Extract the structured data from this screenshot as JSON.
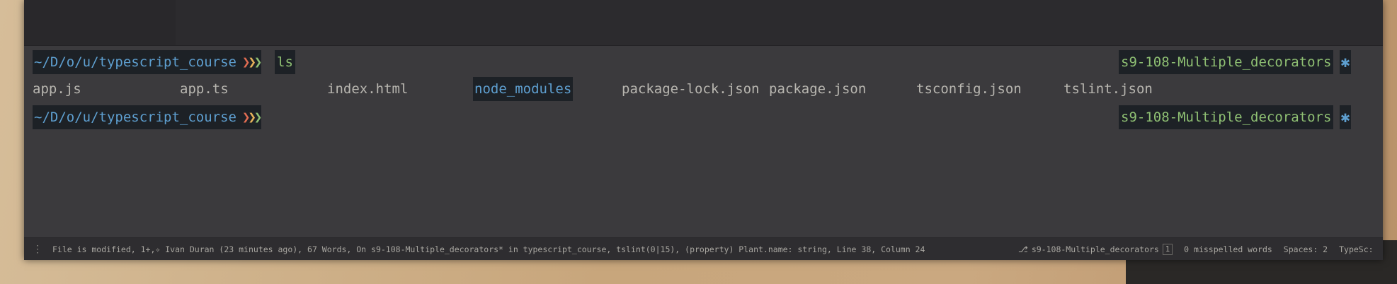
{
  "terminal": {
    "line1": {
      "path": "~/D/o/u/typescript_course",
      "arrows": [
        "❯",
        "❯",
        "❯"
      ],
      "command": "ls",
      "branch": "s9-108-Multiple_decorators",
      "dirty_marker": "✱"
    },
    "listing": [
      {
        "name": "app.js",
        "type": "file"
      },
      {
        "name": "app.ts",
        "type": "file"
      },
      {
        "name": "index.html",
        "type": "file"
      },
      {
        "name": "node_modules",
        "type": "dir"
      },
      {
        "name": "package-lock.json",
        "type": "file"
      },
      {
        "name": "package.json",
        "type": "file"
      },
      {
        "name": "tsconfig.json",
        "type": "file"
      },
      {
        "name": "tslint.json",
        "type": "file"
      }
    ],
    "line3": {
      "path": "~/D/o/u/typescript_course",
      "arrows": [
        "❯",
        "❯",
        "❯"
      ],
      "branch": "s9-108-Multiple_decorators",
      "dirty_marker": "✱"
    }
  },
  "statusbar": {
    "handle": "⋮",
    "info": "File is modified, 1+,✧ Ivan Duran (23 minutes ago), 67 Words, On s9-108-Multiple_decorators* in typescript_course, tslint(0|15), (property) Plant.name: string, Line 38, Column 24",
    "branch_icon": "⎇",
    "branch": "s9-108-Multiple_decorators",
    "branch_badge": "1",
    "misspelled": "0 misspelled words",
    "spaces": "Spaces: 2",
    "language": "TypeSc:"
  },
  "colors": {
    "prompt_path": "#5e9fd0",
    "arrow1": "#e06c52",
    "arrow2": "#e8b35a",
    "arrow3": "#8fc073",
    "branch": "#8fc073",
    "dir": "#5e9fd0",
    "file_text": "#b8b6b0"
  }
}
